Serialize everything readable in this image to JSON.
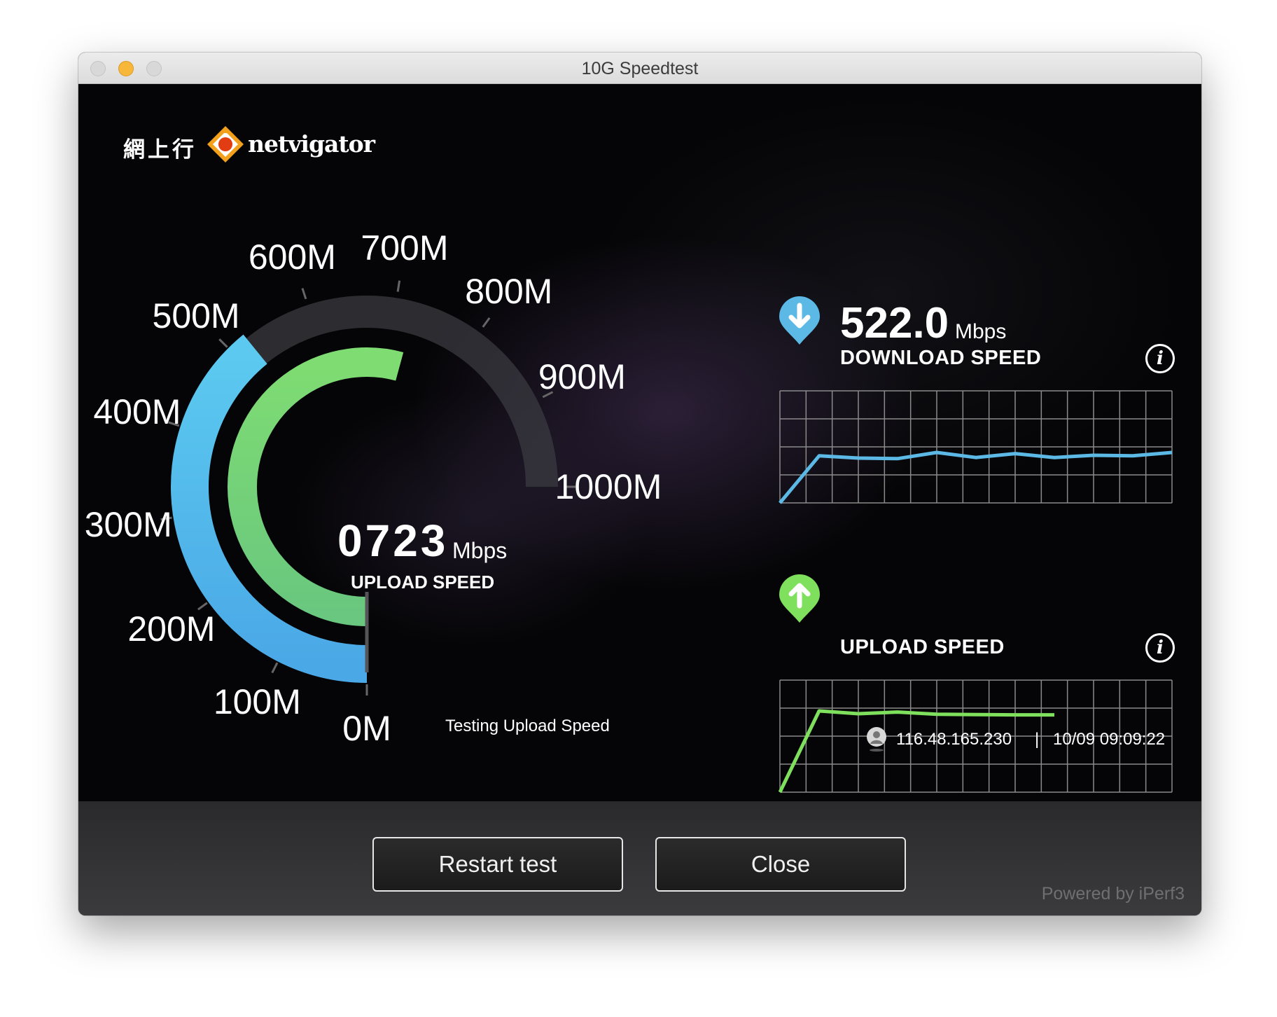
{
  "window": {
    "title": "10G Speedtest"
  },
  "logo": {
    "cjk": "網上行",
    "text": "netvigator"
  },
  "gauge": {
    "max_mbps": 1000,
    "tick_labels": [
      "0M",
      "100M",
      "200M",
      "300M",
      "400M",
      "500M",
      "600M",
      "700M",
      "800M",
      "900M",
      "1000M"
    ],
    "download_value_mbps": 522,
    "upload_value_mbps": 723,
    "center_value": "0723",
    "center_unit": "Mbps",
    "center_label": "UPLOAD SPEED",
    "status": "Testing Upload Speed"
  },
  "download": {
    "value": "522.0",
    "unit": "Mbps",
    "label": "DOWNLOAD SPEED",
    "color": "#5cb8e4",
    "series": [
      0,
      420,
      400,
      395,
      450,
      405,
      440,
      405,
      425,
      420,
      450
    ]
  },
  "upload": {
    "label": "UPLOAD SPEED",
    "color": "#7ee05c",
    "series": [
      0,
      725,
      700,
      715,
      695,
      692,
      690,
      690
    ]
  },
  "chart_data": {
    "type": "line",
    "series": [
      {
        "name": "DOWNLOAD SPEED",
        "values": [
          0,
          420,
          400,
          395,
          450,
          405,
          440,
          405,
          425,
          420,
          450
        ]
      },
      {
        "name": "UPLOAD SPEED",
        "values": [
          0,
          725,
          700,
          715,
          695,
          692,
          690,
          690
        ]
      }
    ],
    "ylim": [
      0,
      1000
    ],
    "grid": true
  },
  "connection": {
    "ip": "116.48.165.230",
    "separator": "|",
    "datetime": "10/09 09:09:22"
  },
  "buttons": {
    "restart": "Restart test",
    "close": "Close"
  },
  "footer": {
    "powered": "Powered by iPerf3"
  }
}
